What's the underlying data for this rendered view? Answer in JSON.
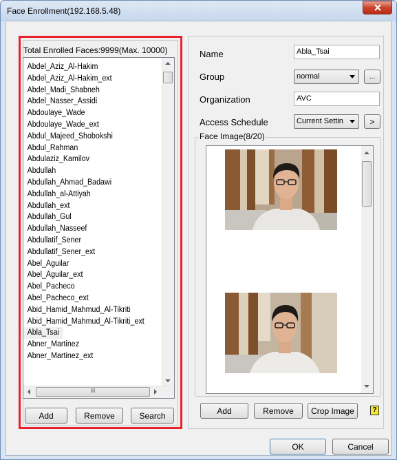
{
  "window": {
    "title": "Face Enrollment(192.168.5.48)"
  },
  "left": {
    "total_label": "Total Enrolled Faces:9999(Max. 10000)",
    "items": [
      "Abdel_Aziz_Al-Hakim",
      "Abdel_Aziz_Al-Hakim_ext",
      "Abdel_Madi_Shabneh",
      "Abdel_Nasser_Assidi",
      "Abdoulaye_Wade",
      "Abdoulaye_Wade_ext",
      "Abdul_Majeed_Shobokshi",
      "Abdul_Rahman",
      "Abdulaziz_Kamilov",
      "Abdullah",
      "Abdullah_Ahmad_Badawi",
      "Abdullah_al-Attiyah",
      "Abdullah_ext",
      "Abdullah_Gul",
      "Abdullah_Nasseef",
      "Abdullatif_Sener",
      "Abdullatif_Sener_ext",
      "Abel_Aguilar",
      "Abel_Aguilar_ext",
      "Abel_Pacheco",
      "Abel_Pacheco_ext",
      "Abid_Hamid_Mahmud_Al-Tikriti",
      "Abid_Hamid_Mahmud_Al-Tikriti_ext",
      "Abla_Tsai",
      "Abner_Martinez",
      "Abner_Martinez_ext"
    ],
    "selected_item": "Abla_Tsai",
    "hscroll_grip": "III",
    "buttons": {
      "add": "Add",
      "remove": "Remove",
      "search": "Search"
    }
  },
  "right": {
    "name_label": "Name",
    "name_value": "Abla_Tsai",
    "group_label": "Group",
    "group_value": "normal",
    "group_more": "...",
    "org_label": "Organization",
    "org_value": "AVC",
    "schedule_label": "Access Schedule",
    "schedule_value": "Current Settin",
    "schedule_next": ">",
    "face_image_label": "Face Image(8/20)",
    "buttons": {
      "add": "Add",
      "remove": "Remove",
      "crop": "Crop Image"
    },
    "help": "?"
  },
  "footer": {
    "ok": "OK",
    "cancel": "Cancel"
  },
  "colors": {
    "highlight_border": "#e8202a",
    "title_bar": "#c4d6ec",
    "close_button": "#c9452d"
  },
  "icons": [
    "close-icon",
    "scroll-up-icon",
    "scroll-down-icon",
    "dropdown-arrow-icon",
    "help-icon"
  ]
}
